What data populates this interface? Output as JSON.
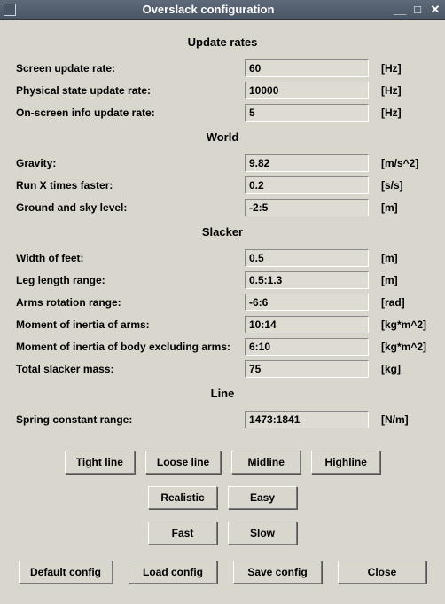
{
  "window": {
    "title": "Overslack configuration"
  },
  "sections": {
    "update_rates": {
      "heading": "Update rates",
      "screen_update_rate": {
        "label": "Screen update rate:",
        "value": "60",
        "unit": "[Hz]"
      },
      "physical_state_update_rate": {
        "label": "Physical state update rate:",
        "value": "10000",
        "unit": "[Hz]"
      },
      "onscreen_info_update_rate": {
        "label": "On-screen info update rate:",
        "value": "5",
        "unit": "[Hz]"
      }
    },
    "world": {
      "heading": "World",
      "gravity": {
        "label": "Gravity:",
        "value": "9.82",
        "unit": "[m/s^2]"
      },
      "run_x_times_faster": {
        "label": "Run X times faster:",
        "value": "0.2",
        "unit": "[s/s]"
      },
      "ground_and_sky_level": {
        "label": "Ground and sky level:",
        "value": "-2:5",
        "unit": "[m]"
      }
    },
    "slacker": {
      "heading": "Slacker",
      "width_of_feet": {
        "label": "Width of feet:",
        "value": "0.5",
        "unit": "[m]"
      },
      "leg_length_range": {
        "label": "Leg length range:",
        "value": "0.5:1.3",
        "unit": "[m]"
      },
      "arms_rotation_range": {
        "label": "Arms rotation range:",
        "value": "-6:6",
        "unit": "[rad]"
      },
      "moment_inertia_arms": {
        "label": "Moment of inertia of arms:",
        "value": "10:14",
        "unit": "[kg*m^2]"
      },
      "moment_inertia_body": {
        "label": "Moment of inertia of body excluding arms:",
        "value": "6:10",
        "unit": "[kg*m^2]"
      },
      "total_slacker_mass": {
        "label": "Total slacker mass:",
        "value": "75",
        "unit": "[kg]"
      }
    },
    "line": {
      "heading": "Line",
      "spring_constant_range": {
        "label": "Spring constant range:",
        "value": "1473:1841",
        "unit": "[N/m]"
      }
    }
  },
  "buttons": {
    "tight_line": "Tight line",
    "loose_line": "Loose line",
    "midline": "Midline",
    "highline": "Highline",
    "realistic": "Realistic",
    "easy": "Easy",
    "fast": "Fast",
    "slow": "Slow",
    "default_config": "Default config",
    "load_config": "Load config",
    "save_config": "Save config",
    "close": "Close"
  }
}
